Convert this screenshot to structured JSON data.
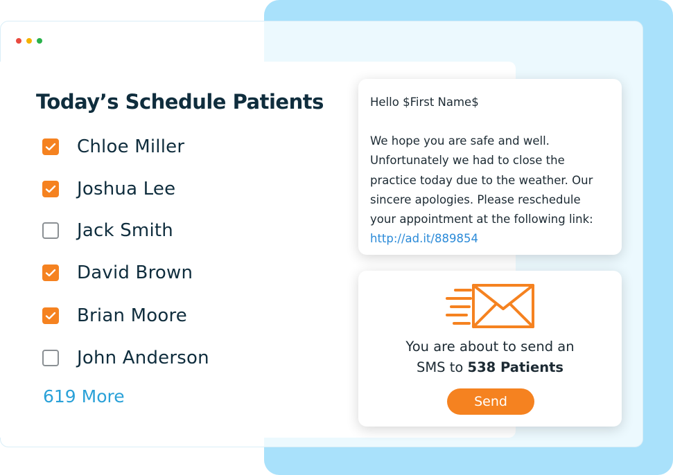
{
  "window": {
    "controls": [
      "close",
      "minimize",
      "maximize"
    ]
  },
  "schedule": {
    "title": "Today’s Schedule Patients",
    "patients": [
      {
        "name": "Chloe Miller",
        "checked": true
      },
      {
        "name": "Joshua Lee",
        "checked": true
      },
      {
        "name": "Jack Smith",
        "checked": false
      },
      {
        "name": "David Brown",
        "checked": true
      },
      {
        "name": "Brian Moore",
        "checked": true
      },
      {
        "name": "John Anderson",
        "checked": false
      }
    ],
    "more_label": "619 More"
  },
  "message": {
    "greeting": "Hello $First Name$",
    "body_lines": [
      "We hope you are safe and well.",
      "Unfortunately we had to close the",
      "practice today due to the weather. Our",
      "sincere apologies. Please reschedule",
      "your appointment at the following link:"
    ],
    "link": "http://ad.it/889854"
  },
  "send": {
    "icon": "envelope-icon",
    "line1": "You are about to send an",
    "line2_prefix": "SMS to ",
    "line2_bold": "538 Patients",
    "button_label": "Send"
  },
  "colors": {
    "accent": "#f58220",
    "backdrop": "#a9e1fb",
    "link": "#2a8ad8",
    "more_link": "#2aa1d8",
    "text_dark": "#0f2d3d"
  }
}
